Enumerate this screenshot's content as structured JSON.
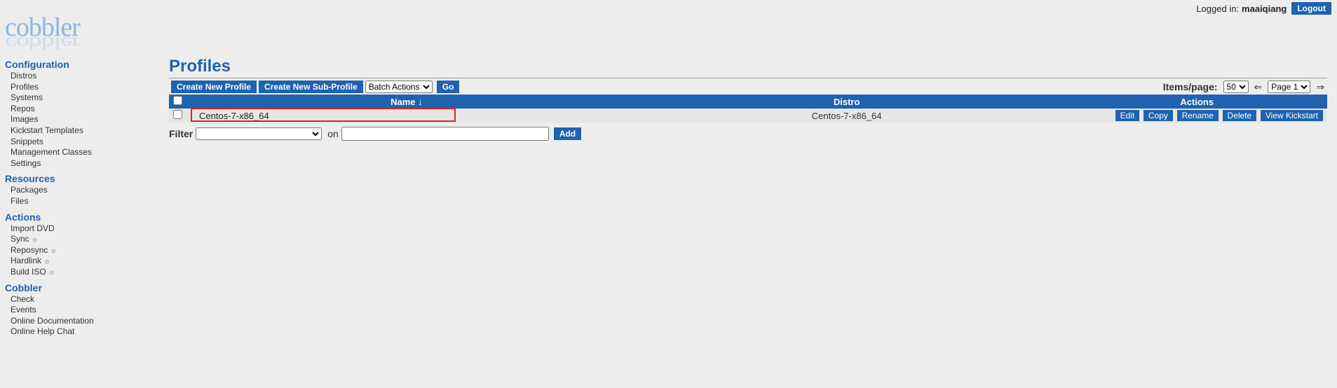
{
  "topbar": {
    "logged_in_prefix": "Logged in:",
    "username": "maaiqiang",
    "logout": "Logout"
  },
  "logo_text": "cobbler",
  "nav": {
    "configuration": {
      "title": "Configuration",
      "items": [
        "Distros",
        "Profiles",
        "Systems",
        "Repos",
        "Images",
        "Kickstart Templates",
        "Snippets",
        "Management Classes",
        "Settings"
      ]
    },
    "resources": {
      "title": "Resources",
      "items": [
        "Packages",
        "Files"
      ]
    },
    "actions": {
      "title": "Actions",
      "items": [
        {
          "label": "Import DVD",
          "gear": false
        },
        {
          "label": "Sync",
          "gear": true
        },
        {
          "label": "Reposync",
          "gear": true
        },
        {
          "label": "Hardlink",
          "gear": true
        },
        {
          "label": "Build ISO",
          "gear": true
        }
      ]
    },
    "cobbler": {
      "title": "Cobbler",
      "items": [
        "Check",
        "Events",
        "Online Documentation",
        "Online Help Chat"
      ]
    }
  },
  "page": {
    "title": "Profiles",
    "create_profile": "Create New Profile",
    "create_sub_profile": "Create New Sub-Profile",
    "batch_actions_label": "Batch Actions",
    "go_label": "Go",
    "items_page_label": "Items/page:",
    "items_page_value": "50",
    "page_select_value": "Page 1",
    "arrow_left": "⇐",
    "arrow_right": "⇒"
  },
  "table": {
    "headers": {
      "name": "Name ↓",
      "distro": "Distro",
      "actions": "Actions"
    },
    "row": {
      "name": "Centos-7-x86_64",
      "distro": "Centos-7-x86_64",
      "actions": {
        "edit": "Edit",
        "copy": "Copy",
        "rename": "Rename",
        "delete": "Delete",
        "view_kickstart": "View Kickstart"
      }
    }
  },
  "filter": {
    "label": "Filter",
    "on_label": "on",
    "add_label": "Add"
  }
}
